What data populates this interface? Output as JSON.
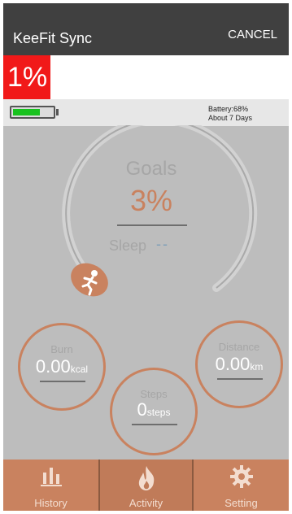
{
  "header": {
    "title": "KeeFit  Sync",
    "cancel_label": "CANCEL"
  },
  "sync": {
    "progress_percent": 1,
    "progress_label": "1%"
  },
  "battery": {
    "level_percent": 68,
    "line1": "Battery:68%",
    "line2": "About 7 Days"
  },
  "goals": {
    "label": "Goals",
    "value": "3%",
    "sleep_label": "Sleep",
    "sleep_value": "--"
  },
  "stats": {
    "burn": {
      "label": "Burn",
      "value": "0.00",
      "unit": "kcal"
    },
    "steps": {
      "label": "Steps",
      "value": "0",
      "unit": "steps"
    },
    "distance": {
      "label": "Distance",
      "value": "0.00",
      "unit": "km"
    }
  },
  "tabs": [
    {
      "label": "History",
      "icon": "bar-chart-icon"
    },
    {
      "label": "Activity",
      "icon": "flame-icon"
    },
    {
      "label": "Setting",
      "icon": "gear-icon"
    }
  ],
  "colors": {
    "accent": "#c9825f",
    "progress_red": "#f11919",
    "battery_green": "#19c21f",
    "header_bg": "#404040",
    "overlay_gray": "#bdbdbd"
  }
}
